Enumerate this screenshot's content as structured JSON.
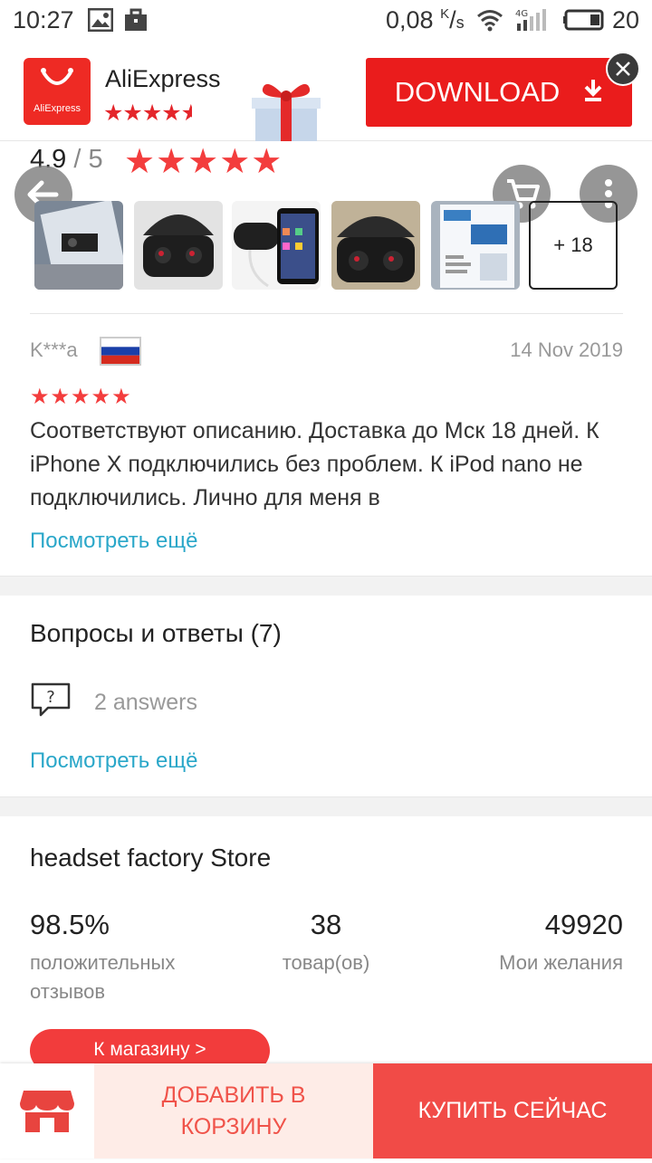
{
  "status_bar": {
    "time": "10:27",
    "speed": "0,08 K/s",
    "network": "4G",
    "battery": "20"
  },
  "ad_banner": {
    "app_name": "AliExpress",
    "logo_text": "AliExpress",
    "app_rating_stars": 4.5,
    "download_label": "DOWNLOAD",
    "accent_color": "#ea1c1c"
  },
  "rating": {
    "score": "4.9",
    "separator": "/",
    "max": "5",
    "stars": 5
  },
  "thumbnails": {
    "more_label": "+ 18"
  },
  "review": {
    "author": "K***a",
    "country_flag": "russia-flag",
    "date": "14 Nov 2019",
    "stars": 5,
    "text": "Соответствуют описанию. Доставка до Мск 18 дней. К iPhone X подключились без проблем. К iPod nano не подключились. Лично для меня в",
    "see_more": "Посмотреть ещё"
  },
  "qa": {
    "title": "Вопросы и ответы (7)",
    "answers": "2 answers",
    "see_more": "Посмотреть ещё"
  },
  "store": {
    "name": "headset factory Store",
    "stats": [
      {
        "value": "98.5%",
        "label": "положительных отзывов"
      },
      {
        "value": "38",
        "label": "товар(ов)"
      },
      {
        "value": "49920",
        "label": "Мои желания"
      }
    ],
    "shop_button": "К магазину >"
  },
  "bottom_bar": {
    "add_to_cart": "ДОБАВИТЬ В КОРЗИНУ",
    "buy_now": "КУПИТЬ СЕЙЧАС"
  },
  "colors": {
    "brand_red": "#f14b47",
    "link": "#2aa7c9",
    "star": "#f33d3d"
  }
}
